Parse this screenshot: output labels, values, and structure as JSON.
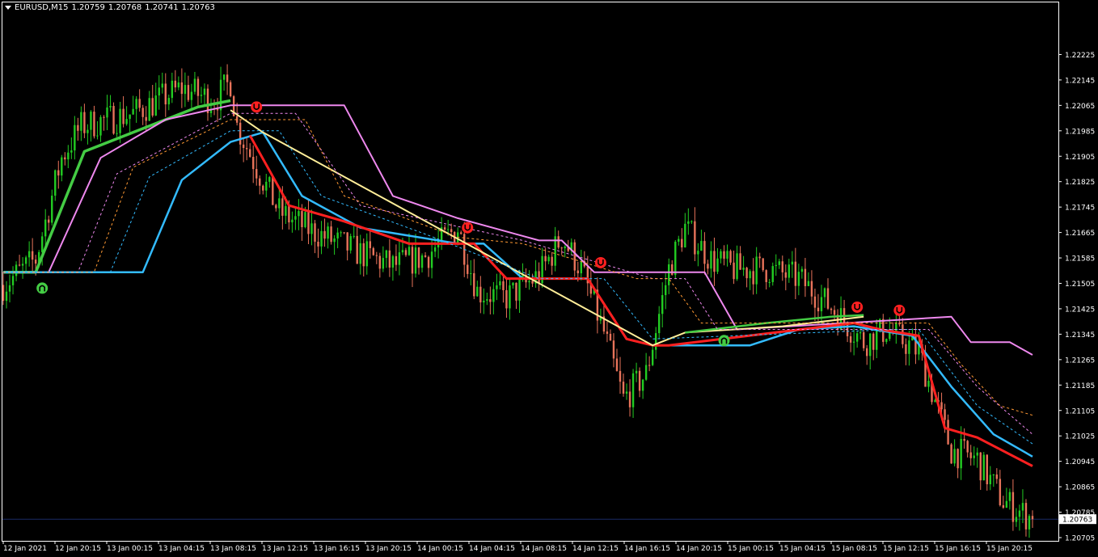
{
  "header": {
    "symbol_timeframe": "EURUSD,M15",
    "open": "1.20759",
    "high": "1.20768",
    "low": "1.20741",
    "close": "1.20763"
  },
  "colors": {
    "background": "#000000",
    "frame": "#ffffff",
    "bull_candle": "#22cc22",
    "bear_candle": "#e8735a",
    "ema_green": "#44cc44",
    "ema_pink": "#ee88ee",
    "ema_red": "#ff2020",
    "ema_blue": "#33bbff",
    "ema_yellow": "#ffee99",
    "dash_orange": "#ff9933",
    "current_price_line": "#1a2a66",
    "signal_up": "#44cc44",
    "signal_down": "#ff2020"
  },
  "chart_data": {
    "type": "candlestick",
    "symbol": "EURUSD",
    "timeframe": "M15",
    "current_price": 1.20763,
    "ylim": [
      1.20705,
      1.22305
    ],
    "y_ticks": [
      "1.22225",
      "1.22145",
      "1.22065",
      "1.21985",
      "1.21905",
      "1.21825",
      "1.21745",
      "1.21665",
      "1.21585",
      "1.21505",
      "1.21425",
      "1.21345",
      "1.21265",
      "1.21185",
      "1.21105",
      "1.21025",
      "1.20945",
      "1.20865",
      "1.20785",
      "1.20705"
    ],
    "x_ticks": [
      "12 Jan 2021",
      "12 Jan 20:15",
      "13 Jan 00:15",
      "13 Jan 04:15",
      "13 Jan 08:15",
      "13 Jan 12:15",
      "13 Jan 16:15",
      "13 Jan 20:15",
      "14 Jan 00:15",
      "14 Jan 04:15",
      "14 Jan 08:15",
      "14 Jan 12:15",
      "14 Jan 16:15",
      "14 Jan 20:15",
      "15 Jan 00:15",
      "15 Jan 04:15",
      "15 Jan 08:15",
      "15 Jan 12:15",
      "15 Jan 16:15",
      "15 Jan 20:15"
    ],
    "candle_count": 318,
    "price_path": [
      {
        "i": 0,
        "p": 1.215
      },
      {
        "i": 10,
        "p": 1.2158
      },
      {
        "i": 18,
        "p": 1.219
      },
      {
        "i": 24,
        "p": 1.22
      },
      {
        "i": 40,
        "p": 1.2204
      },
      {
        "i": 55,
        "p": 1.2212
      },
      {
        "i": 65,
        "p": 1.2208
      },
      {
        "i": 70,
        "p": 1.2214
      },
      {
        "i": 72,
        "p": 1.22
      },
      {
        "i": 78,
        "p": 1.2187
      },
      {
        "i": 85,
        "p": 1.2173
      },
      {
        "i": 95,
        "p": 1.2167
      },
      {
        "i": 110,
        "p": 1.216
      },
      {
        "i": 120,
        "p": 1.2156
      },
      {
        "i": 130,
        "p": 1.2159
      },
      {
        "i": 140,
        "p": 1.2168
      },
      {
        "i": 146,
        "p": 1.2148
      },
      {
        "i": 155,
        "p": 1.2146
      },
      {
        "i": 165,
        "p": 1.2153
      },
      {
        "i": 172,
        "p": 1.2165
      },
      {
        "i": 178,
        "p": 1.2155
      },
      {
        "i": 185,
        "p": 1.2135
      },
      {
        "i": 191,
        "p": 1.2114
      },
      {
        "i": 198,
        "p": 1.2122
      },
      {
        "i": 205,
        "p": 1.2155
      },
      {
        "i": 210,
        "p": 1.2168
      },
      {
        "i": 218,
        "p": 1.2158
      },
      {
        "i": 225,
        "p": 1.2155
      },
      {
        "i": 235,
        "p": 1.2155
      },
      {
        "i": 245,
        "p": 1.2152
      },
      {
        "i": 255,
        "p": 1.2143
      },
      {
        "i": 265,
        "p": 1.2132
      },
      {
        "i": 272,
        "p": 1.2136
      },
      {
        "i": 282,
        "p": 1.2129
      },
      {
        "i": 292,
        "p": 1.2098
      },
      {
        "i": 300,
        "p": 1.2095
      },
      {
        "i": 308,
        "p": 1.2082
      },
      {
        "i": 317,
        "p": 1.20763
      }
    ],
    "indicators": [
      {
        "color_key": "ema_green",
        "style": "solid",
        "width": 3.5,
        "points": [
          {
            "i": 0,
            "p": 1.2154
          },
          {
            "i": 10,
            "p": 1.2154
          },
          {
            "i": 25,
            "p": 1.2192
          },
          {
            "i": 45,
            "p": 1.22
          },
          {
            "i": 60,
            "p": 1.2206
          },
          {
            "i": 70,
            "p": 1.2208
          }
        ]
      },
      {
        "color_key": "ema_pink",
        "style": "solid",
        "width": 2,
        "points": [
          {
            "i": 0,
            "p": 1.2154
          },
          {
            "i": 14,
            "p": 1.2154
          },
          {
            "i": 30,
            "p": 1.219
          },
          {
            "i": 50,
            "p": 1.2202
          },
          {
            "i": 70,
            "p": 1.22065
          },
          {
            "i": 105,
            "p": 1.22065
          },
          {
            "i": 120,
            "p": 1.2178
          },
          {
            "i": 140,
            "p": 1.2171
          },
          {
            "i": 165,
            "p": 1.2164
          },
          {
            "i": 172,
            "p": 1.2164
          },
          {
            "i": 182,
            "p": 1.2154
          },
          {
            "i": 216,
            "p": 1.2154
          },
          {
            "i": 226,
            "p": 1.2136
          },
          {
            "i": 292,
            "p": 1.214
          },
          {
            "i": 298,
            "p": 1.2132
          },
          {
            "i": 310,
            "p": 1.2132
          },
          {
            "i": 317,
            "p": 1.2128
          }
        ]
      },
      {
        "color_key": "ema_blue",
        "style": "solid",
        "width": 2.5,
        "points": [
          {
            "i": 0,
            "p": 1.2154
          },
          {
            "i": 43,
            "p": 1.2154
          },
          {
            "i": 55,
            "p": 1.2183
          },
          {
            "i": 70,
            "p": 1.2195
          },
          {
            "i": 80,
            "p": 1.2198
          },
          {
            "i": 92,
            "p": 1.2178
          },
          {
            "i": 110,
            "p": 1.2168
          },
          {
            "i": 140,
            "p": 1.2163
          },
          {
            "i": 148,
            "p": 1.2163
          },
          {
            "i": 160,
            "p": 1.2152
          },
          {
            "i": 180,
            "p": 1.2152
          },
          {
            "i": 192,
            "p": 1.2133
          },
          {
            "i": 200,
            "p": 1.2131
          },
          {
            "i": 230,
            "p": 1.2131
          },
          {
            "i": 245,
            "p": 1.2136
          },
          {
            "i": 262,
            "p": 1.2137
          },
          {
            "i": 280,
            "p": 1.2134
          },
          {
            "i": 292,
            "p": 1.2118
          },
          {
            "i": 305,
            "p": 1.2103
          },
          {
            "i": 317,
            "p": 1.2096
          }
        ]
      },
      {
        "color_key": "ema_red",
        "style": "solid",
        "width": 3,
        "points": [
          {
            "i": 76,
            "p": 1.2197
          },
          {
            "i": 88,
            "p": 1.2175
          },
          {
            "i": 105,
            "p": 1.217
          },
          {
            "i": 125,
            "p": 1.2163
          },
          {
            "i": 145,
            "p": 1.2163
          },
          {
            "i": 155,
            "p": 1.2152
          },
          {
            "i": 180,
            "p": 1.2152
          },
          {
            "i": 192,
            "p": 1.2133
          },
          {
            "i": 200,
            "p": 1.2131
          },
          {
            "i": 205,
            "p": 1.2131
          },
          {
            "i": 262,
            "p": 1.2138
          },
          {
            "i": 270,
            "p": 1.2136
          },
          {
            "i": 282,
            "p": 1.2134
          },
          {
            "i": 290,
            "p": 1.2105
          },
          {
            "i": 300,
            "p": 1.2102
          },
          {
            "i": 317,
            "p": 1.2093
          }
        ]
      },
      {
        "color_key": "ema_yellow",
        "style": "solid",
        "width": 2,
        "points": [
          {
            "i": 70,
            "p": 1.2205
          },
          {
            "i": 80,
            "p": 1.2198
          },
          {
            "i": 200,
            "p": 1.2131
          },
          {
            "i": 210,
            "p": 1.2135
          },
          {
            "i": 240,
            "p": 1.2137
          },
          {
            "i": 265,
            "p": 1.214
          }
        ]
      },
      {
        "color_key": "ema_green",
        "style": "solid",
        "width": 2.5,
        "points": [
          {
            "i": 210,
            "p": 1.2135
          },
          {
            "i": 235,
            "p": 1.2138
          },
          {
            "i": 255,
            "p": 1.214
          },
          {
            "i": 265,
            "p": 1.21405
          }
        ]
      },
      {
        "color_key": "ema_blue",
        "style": "dashed",
        "width": 1,
        "points": [
          {
            "i": 0,
            "p": 1.2154
          },
          {
            "i": 33,
            "p": 1.2154
          },
          {
            "i": 45,
            "p": 1.2184
          },
          {
            "i": 70,
            "p": 1.21985
          },
          {
            "i": 85,
            "p": 1.21985
          },
          {
            "i": 98,
            "p": 1.2178
          },
          {
            "i": 130,
            "p": 1.2166
          },
          {
            "i": 165,
            "p": 1.2152
          },
          {
            "i": 185,
            "p": 1.2152
          },
          {
            "i": 200,
            "p": 1.2133
          },
          {
            "i": 275,
            "p": 1.2136
          },
          {
            "i": 282,
            "p": 1.2136
          },
          {
            "i": 300,
            "p": 1.2112
          },
          {
            "i": 317,
            "p": 1.21
          }
        ]
      },
      {
        "color_key": "ema_pink",
        "style": "dashed",
        "width": 1,
        "points": [
          {
            "i": 0,
            "p": 1.2154
          },
          {
            "i": 23,
            "p": 1.2154
          },
          {
            "i": 35,
            "p": 1.2185
          },
          {
            "i": 70,
            "p": 1.2204
          },
          {
            "i": 90,
            "p": 1.2204
          },
          {
            "i": 110,
            "p": 1.2175
          },
          {
            "i": 160,
            "p": 1.2164
          },
          {
            "i": 200,
            "p": 1.2152
          },
          {
            "i": 210,
            "p": 1.2152
          },
          {
            "i": 220,
            "p": 1.2136
          },
          {
            "i": 285,
            "p": 1.2136
          },
          {
            "i": 300,
            "p": 1.2118
          },
          {
            "i": 317,
            "p": 1.2103
          }
        ]
      },
      {
        "color_key": "dash_orange",
        "style": "dashed",
        "width": 1,
        "points": [
          {
            "i": 0,
            "p": 1.2154
          },
          {
            "i": 28,
            "p": 1.2154
          },
          {
            "i": 40,
            "p": 1.2187
          },
          {
            "i": 70,
            "p": 1.2202
          },
          {
            "i": 93,
            "p": 1.2202
          },
          {
            "i": 105,
            "p": 1.2178
          },
          {
            "i": 140,
            "p": 1.2165
          },
          {
            "i": 160,
            "p": 1.2163
          },
          {
            "i": 195,
            "p": 1.2152
          },
          {
            "i": 205,
            "p": 1.2152
          },
          {
            "i": 215,
            "p": 1.2138
          },
          {
            "i": 285,
            "p": 1.2138
          },
          {
            "i": 295,
            "p": 1.2125
          },
          {
            "i": 307,
            "p": 1.2112
          },
          {
            "i": 317,
            "p": 1.2109
          }
        ]
      }
    ],
    "signals": [
      {
        "type": "buy",
        "i": 12,
        "p": 1.2149
      },
      {
        "type": "sell",
        "i": 78,
        "p": 1.2206
      },
      {
        "type": "sell",
        "i": 143,
        "p": 1.2168
      },
      {
        "type": "sell",
        "i": 184,
        "p": 1.2157
      },
      {
        "type": "buy",
        "i": 222,
        "p": 1.21325
      },
      {
        "type": "sell",
        "i": 263,
        "p": 1.2143
      },
      {
        "type": "sell",
        "i": 276,
        "p": 1.2142
      }
    ]
  }
}
